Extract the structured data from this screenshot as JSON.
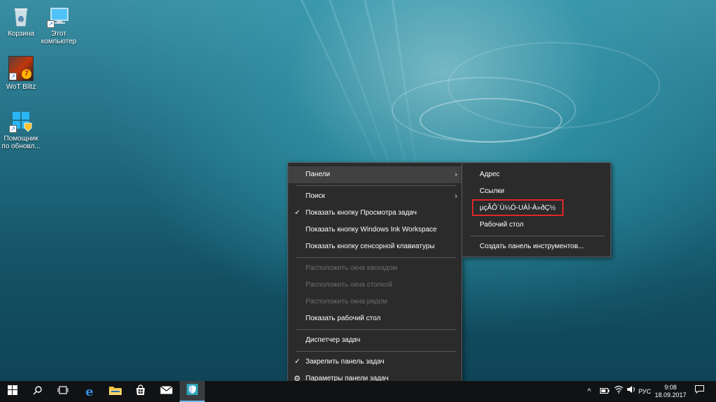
{
  "desktop": {
    "icons": [
      {
        "label": "Корзина",
        "icon": "recycle-bin-icon"
      },
      {
        "label": "Этот компьютер",
        "icon": "computer-icon"
      },
      {
        "label": "WoT Blitz",
        "icon": "wot-blitz-icon"
      },
      {
        "label": "Помощник по обновл...",
        "icon": "windows-update-assistant-icon"
      }
    ]
  },
  "context_menu": {
    "items": [
      {
        "label": "Панели",
        "submenu": true,
        "highlighted": true
      },
      {
        "label": "Поиск",
        "submenu": true
      },
      {
        "label": "Показать кнопку Просмотра задач",
        "checked": true
      },
      {
        "label": "Показать кнопку Windows Ink Workspace"
      },
      {
        "label": "Показать кнопку сенсорной клавиатуры"
      },
      {
        "label": "Расположить окна каскадом",
        "disabled": true
      },
      {
        "label": "Расположить окна стопкой",
        "disabled": true
      },
      {
        "label": "Расположить окна рядом",
        "disabled": true
      },
      {
        "label": "Показать рабочий стол"
      },
      {
        "label": "Диспетчер задач"
      },
      {
        "label": "Закрепить панель задач",
        "checked": true
      },
      {
        "label": "Параметры панели задач",
        "icon": "gear-icon"
      }
    ]
  },
  "submenu": {
    "items": [
      {
        "label": "Адрес"
      },
      {
        "label": "Ссылки"
      },
      {
        "label": "µçÃÔ´Ù¼Ó-UÀÌ-À»ðÇ½",
        "annotated": true
      },
      {
        "label": "Рабочий стол"
      },
      {
        "label": "Создать панель инструментов..."
      }
    ],
    "annotation_color": "#e0262b"
  },
  "taskbar": {
    "pinned": [
      "start-icon",
      "search-icon",
      "task-view-icon",
      "edge-icon",
      "file-explorer-icon",
      "store-icon",
      "mail-icon",
      "defender-icon"
    ],
    "tray": {
      "language": "РУС",
      "time": "9:08",
      "date": "18.09.2017"
    }
  },
  "colors": {
    "menu_bg": "#2b2b2b",
    "menu_highlight": "#414141",
    "taskbar_bg": "#101214",
    "accent": "#0078d7"
  }
}
